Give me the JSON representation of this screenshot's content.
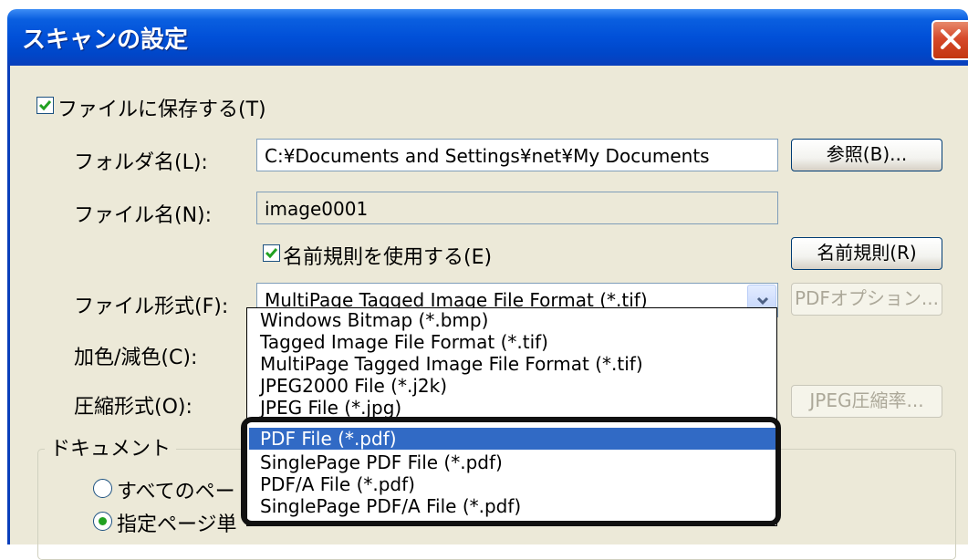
{
  "dialog": {
    "title": "スキャンの設定"
  },
  "save_to_file": {
    "label": "ファイルに保存する(T)",
    "checked": true
  },
  "folder": {
    "label": "フォルダ名(L):",
    "value": "C:¥Documents and Settings¥net¥My Documents",
    "browse_label": "参照(B)..."
  },
  "filename": {
    "label": "ファイル名(N):",
    "value": "image0001"
  },
  "naming_rule": {
    "label": "名前規則を使用する(E)",
    "checked": true,
    "button_label": "名前規則(R)"
  },
  "file_format": {
    "label": "ファイル形式(F):",
    "value": "MultiPage Tagged Image File Format (*.tif)",
    "pdf_options_label": "PDFオプション...",
    "options": [
      "Windows Bitmap (*.bmp)",
      "Tagged Image File Format (*.tif)",
      "MultiPage Tagged Image File Format (*.tif)",
      "JPEG2000 File (*.j2k)",
      "JPEG File (*.jpg)",
      "PDF File (*.pdf)",
      "SinglePage PDF File (*.pdf)",
      "PDF/A File (*.pdf)",
      "SinglePage PDF/A File (*.pdf)"
    ],
    "selected_option": "PDF File (*.pdf)"
  },
  "color_reduction": {
    "label": "加色/減色(C):"
  },
  "compression": {
    "label": "圧縮形式(O):",
    "jpeg_button_label": "JPEG圧縮率..."
  },
  "document_group": {
    "label": "ドキュメント",
    "radio_all_label": "すべてのペー",
    "radio_pages_label": "指定ページ単"
  },
  "colors": {
    "title_blue": "#0050d8",
    "dialog_bg": "#ece9d8",
    "selection": "#316ac5",
    "check_green": "#21a121"
  }
}
